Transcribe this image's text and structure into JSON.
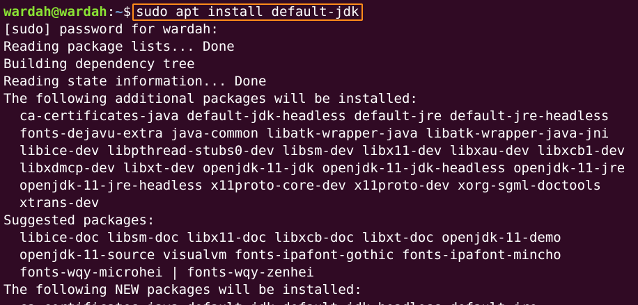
{
  "prompt": {
    "user_host": "wardah@wardah",
    "separator": ":",
    "path": "~",
    "symbol": "$",
    "command": "sudo apt install default-jdk"
  },
  "output_lines": [
    "[sudo] password for wardah:",
    "Reading package lists... Done",
    "Building dependency tree",
    "Reading state information... Done",
    "The following additional packages will be installed:",
    "  ca-certificates-java default-jdk-headless default-jre default-jre-headless",
    "  fonts-dejavu-extra java-common libatk-wrapper-java libatk-wrapper-java-jni",
    "  libice-dev libpthread-stubs0-dev libsm-dev libx11-dev libxau-dev libxcb1-dev",
    "  libxdmcp-dev libxt-dev openjdk-11-jdk openjdk-11-jdk-headless openjdk-11-jre",
    "  openjdk-11-jre-headless x11proto-core-dev x11proto-dev xorg-sgml-doctools",
    "  xtrans-dev",
    "Suggested packages:",
    "  libice-doc libsm-doc libx11-doc libxcb-doc libxt-doc openjdk-11-demo",
    "  openjdk-11-source visualvm fonts-ipafont-gothic fonts-ipafont-mincho",
    "  fonts-wqy-microhei | fonts-wqy-zenhei",
    "The following NEW packages will be installed:",
    "  ca-certificates-java default-jdk default-jdk-headless default-jre"
  ],
  "colors": {
    "background": "#300a24",
    "user_host": "#8ae234",
    "path": "#729fcf",
    "text": "#ffffff",
    "highlight_border": "#ff8c1a"
  }
}
